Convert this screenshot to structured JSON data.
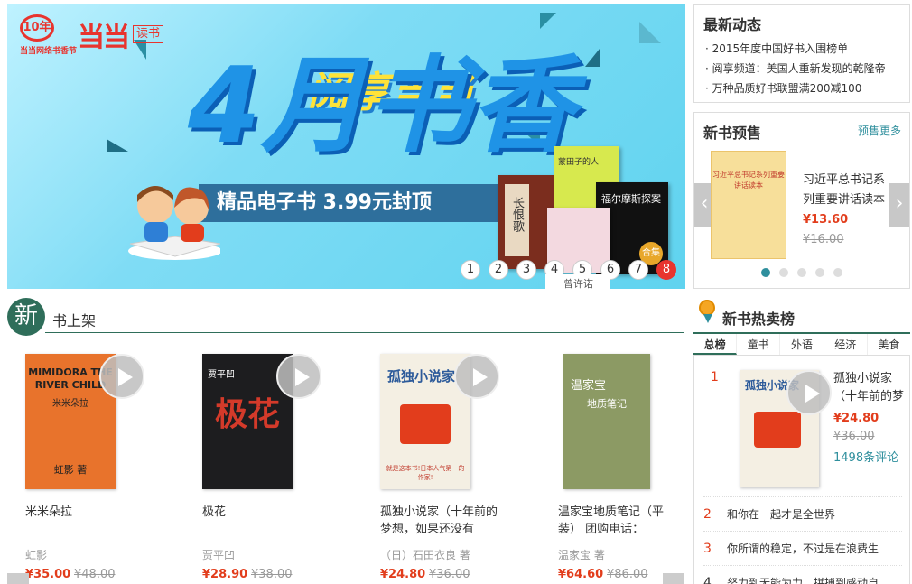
{
  "banner": {
    "logo_10": "10年",
    "logo_sub": "当当网络书香节",
    "dd_logo": "当当",
    "dushu": "读书",
    "headline_big": "4月书香",
    "headline_small": "阅享当当",
    "ribbon": "精品电子书 3.99元封顶",
    "book_labels": [
      "长恨歌",
      "蒙田子的人",
      "福尔摩斯探案",
      "合集"
    ],
    "caption": "曾许诺",
    "slides": [
      "1",
      "2",
      "3",
      "4",
      "5",
      "6",
      "7",
      "8"
    ],
    "active_slide": "8"
  },
  "news": {
    "title": "最新动态",
    "items": [
      "· 2015年度中国好书入围榜单",
      "· 阅享频道：美国人重新发现的乾隆帝",
      "· 万种品质好书联盟满200减100"
    ]
  },
  "presale": {
    "title": "新书预售",
    "more": "预售更多",
    "book_cover_text": "习近平总书记系列重要讲话读本",
    "book_name": "习近平总书记系列重要讲话读本",
    "price": "¥13.60",
    "orig_price": "¥16.00",
    "prev": "‹",
    "next": "›"
  },
  "shelf": {
    "badge": "新",
    "title": "书上架",
    "items": [
      {
        "name": "米米朵拉",
        "author": "虹影",
        "price": "¥35.00",
        "orig": "¥48.00",
        "cover_title": "MIMIDORA THE RIVER CHILD",
        "cover_sub": "米米朵拉",
        "cover_author": "虹影 著"
      },
      {
        "name": "极花",
        "author": "贾平凹",
        "price": "¥28.90",
        "orig": "¥38.00",
        "cover_title": "极花",
        "cover_sub": "贾平凹",
        "cover_author": ""
      },
      {
        "name": "孤独小说家（十年前的梦想，如果还没有",
        "author": "（日）石田衣良 著",
        "price": "¥24.80",
        "orig": "¥36.00",
        "cover_title": "孤独小说家",
        "cover_sub": "就是这本书!日本人气第一的作家!",
        "cover_author": ""
      },
      {
        "name": "温家宝地质笔记（平装） 团购电话：",
        "author": "温家宝 著",
        "price": "¥64.60",
        "orig": "¥86.00",
        "cover_title": "温家宝",
        "cover_sub": "地质笔记",
        "cover_author": ""
      }
    ]
  },
  "hot": {
    "title": "新书热卖榜",
    "tabs": [
      "总榜",
      "童书",
      "外语",
      "经济",
      "美食"
    ],
    "first": {
      "rank": "1",
      "name": "孤独小说家（十年前的梦",
      "price": "¥24.80",
      "orig": "¥36.00",
      "reviews": "1498条评论",
      "cover_title": "孤独小说家"
    },
    "rows": [
      {
        "rank": "2",
        "name": "和你在一起才是全世界"
      },
      {
        "rank": "3",
        "name": "你所谓的稳定，不过是在浪费生"
      },
      {
        "rank": "4",
        "name": "努力到无能为力，拼搏到感动自"
      }
    ]
  },
  "colors": {
    "accent": "#e23d1c",
    "teal": "#2f8f9d",
    "green": "#2f6e5a",
    "banner_bg": "#7fdcf5"
  }
}
